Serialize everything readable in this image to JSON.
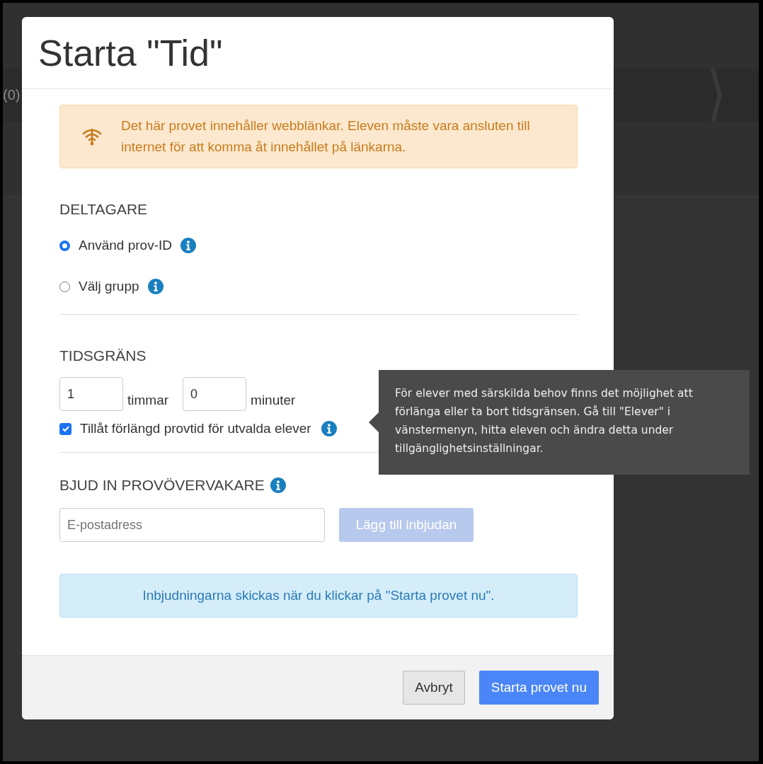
{
  "background": {
    "fragment": "(0)"
  },
  "dialog": {
    "title": "Starta \"Tid\"",
    "notice": {
      "text": "Det här provet innehåller webblänkar. Eleven måste vara ansluten till internet för att komma åt innehållet på länkarna."
    },
    "participants": {
      "heading": "DELTAGARE",
      "options": [
        {
          "label": "Använd prov-ID",
          "selected": true
        },
        {
          "label": "Välj grupp",
          "selected": false
        }
      ]
    },
    "time_limit": {
      "heading": "TIDSGRÄNS",
      "hours": {
        "value": "1",
        "unit": "timmar"
      },
      "minutes": {
        "value": "0",
        "unit": "minuter"
      },
      "extended_time": {
        "label": "Tillåt förlängd provtid för utvalda elever",
        "checked": true
      }
    },
    "invite": {
      "heading": "BJUD IN PROVÖVERVAKARE",
      "email": {
        "placeholder": "E-postadress"
      },
      "add_button": {
        "label": "Lägg till inbjudan",
        "disabled": true
      },
      "info": "Inbjudningarna skickas när du klickar på \"Starta provet nu\"."
    },
    "buttons": [
      {
        "label": "Avbryt",
        "kind": "secondary"
      },
      {
        "label": "Starta provet nu",
        "kind": "primary"
      }
    ]
  },
  "tooltip": {
    "text": "För elever med särskilda behov finns det möjlighet att förlänga eller ta bort tidsgränsen. Gå till \"Elever\" i vänstermenyn, hitta eleven och ändra detta under tillgänglighetsinställningar."
  }
}
